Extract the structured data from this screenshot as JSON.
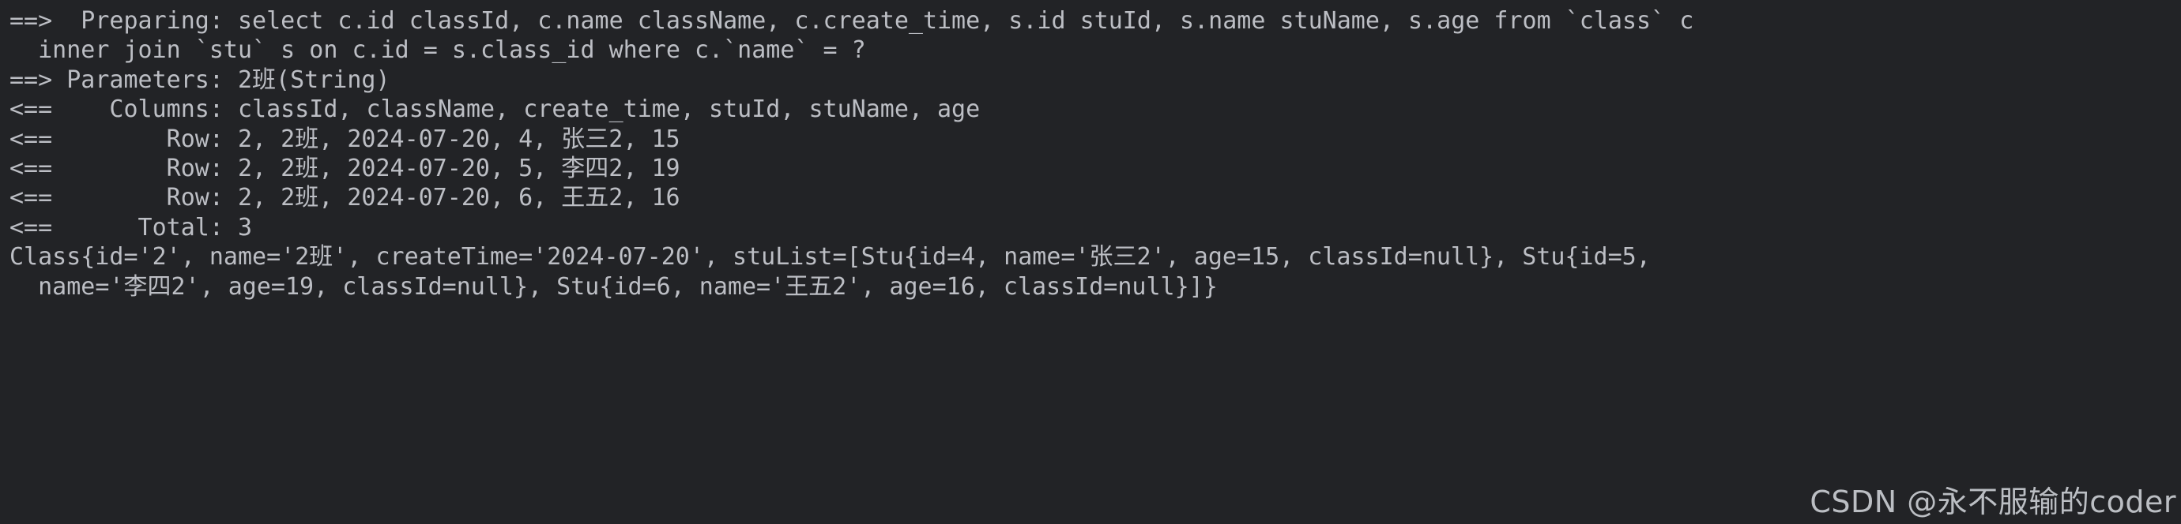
{
  "console": {
    "background_color": "#222326",
    "text_color": "#bcbec4",
    "lines": [
      "==>  Preparing: select c.id classId, c.name className, c.create_time, s.id stuId, s.name stuName, s.age from `class` c",
      "  inner join `stu` s on c.id = s.class_id where c.`name` = ?",
      "==> Parameters: 2班(String)",
      "<==    Columns: classId, className, create_time, stuId, stuName, age",
      "<==        Row: 2, 2班, 2024-07-20, 4, 张三2, 15",
      "<==        Row: 2, 2班, 2024-07-20, 5, 李四2, 19",
      "<==        Row: 2, 2班, 2024-07-20, 6, 王五2, 16",
      "<==      Total: 3",
      "Class{id='2', name='2班', createTime='2024-07-20', stuList=[Stu{id=4, name='张三2', age=15, classId=null}, Stu{id=5,",
      "  name='李四2', age=19, classId=null}, Stu{id=6, name='王五2', age=16, classId=null}]}"
    ]
  },
  "watermark": {
    "text": "CSDN @永不服输的coder"
  }
}
